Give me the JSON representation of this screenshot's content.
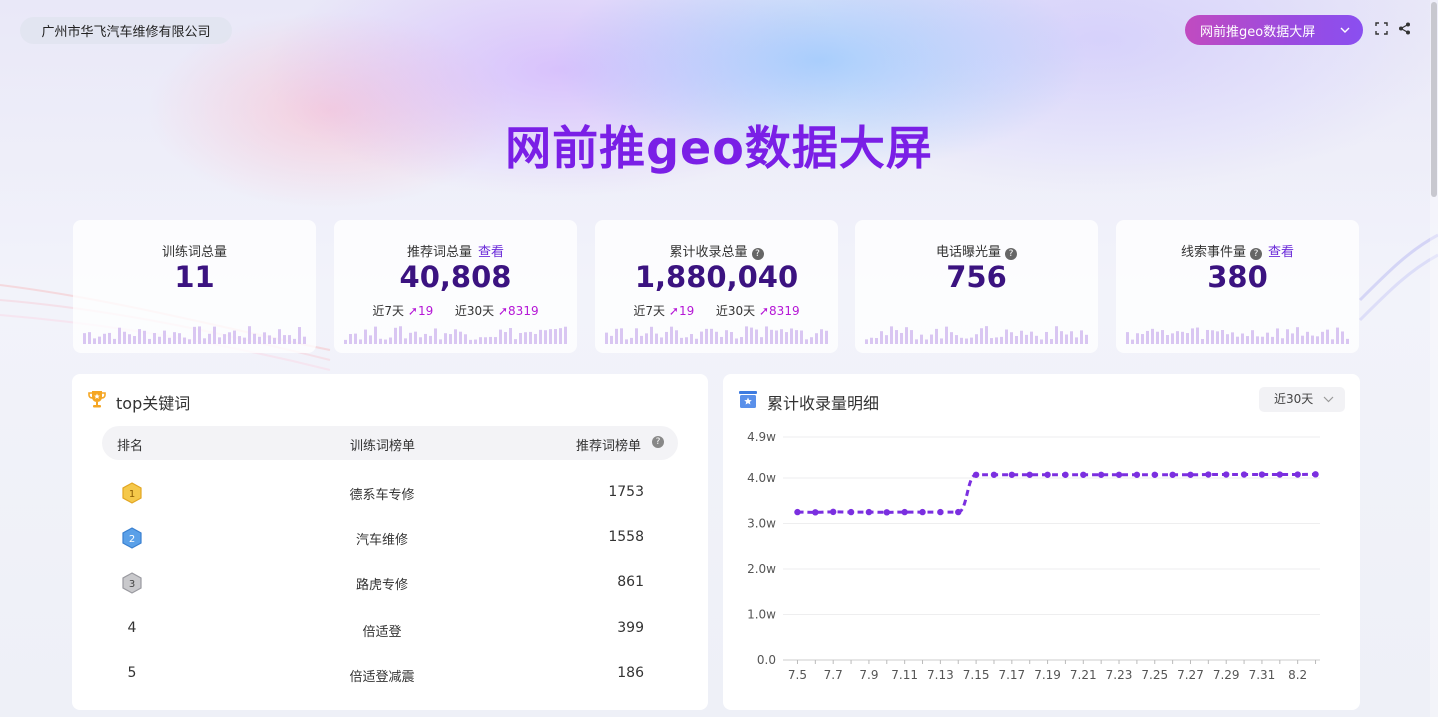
{
  "header": {
    "company": "广州市华飞汽车维修有限公司",
    "screen_select": "网前推geo数据大屏",
    "title": "网前推geo数据大屏"
  },
  "stats": [
    {
      "label": "训练词总量",
      "value": "11",
      "link": "",
      "help": false
    },
    {
      "label": "推荐词总量",
      "value": "40,808",
      "link": "查看",
      "help": false,
      "trend": {
        "label7": "近7天",
        "val7": "19",
        "label30": "近30天",
        "val30": "8319"
      }
    },
    {
      "label": "累计收录总量",
      "value": "1,880,040",
      "link": "",
      "help": true,
      "trend": {
        "label7": "近7天",
        "val7": "19",
        "label30": "近30天",
        "val30": "8319"
      }
    },
    {
      "label": "电话曝光量",
      "value": "756",
      "link": "",
      "help": true
    },
    {
      "label": "线索事件量",
      "value": "380",
      "link": "查看",
      "help": true
    }
  ],
  "top_keywords": {
    "title": "top关键词",
    "headers": {
      "rank": "排名",
      "train": "训练词榜单",
      "recommend": "推荐词榜单"
    },
    "rows": [
      {
        "rank": "1",
        "keyword": "德系车专修",
        "count": "1753"
      },
      {
        "rank": "2",
        "keyword": "汽车维修",
        "count": "1558"
      },
      {
        "rank": "3",
        "keyword": "路虎专修",
        "count": "861"
      },
      {
        "rank": "4",
        "keyword": "倍适登",
        "count": "399"
      },
      {
        "rank": "5",
        "keyword": "倍适登减震",
        "count": "186"
      }
    ]
  },
  "records_panel": {
    "title": "累计收录量明细",
    "period": "近30天"
  },
  "chart_data": {
    "type": "line",
    "title": "",
    "xlabel": "",
    "ylabel": "",
    "x": [
      "7.5",
      "7.6",
      "7.7",
      "7.8",
      "7.9",
      "7.10",
      "7.11",
      "7.12",
      "7.13",
      "7.14",
      "7.15",
      "7.16",
      "7.17",
      "7.18",
      "7.19",
      "7.20",
      "7.21",
      "7.22",
      "7.23",
      "7.24",
      "7.25",
      "7.26",
      "7.27",
      "7.28",
      "7.29",
      "7.30",
      "7.31",
      "8.1",
      "8.2",
      "8.3"
    ],
    "x_tick_labels": [
      "7.5",
      "7.7",
      "7.9",
      "7.11",
      "7.13",
      "7.15",
      "7.17",
      "7.19",
      "7.21",
      "7.23",
      "7.25",
      "7.27",
      "7.29",
      "7.31",
      "8.2"
    ],
    "series": [
      {
        "values": [
          32500,
          32450,
          32550,
          32500,
          32500,
          32450,
          32500,
          32500,
          32500,
          32500,
          40700,
          40700,
          40700,
          40700,
          40700,
          40700,
          40700,
          40700,
          40700,
          40700,
          40700,
          40700,
          40700,
          40750,
          40750,
          40750,
          40750,
          40750,
          40750,
          40800
        ]
      }
    ],
    "y_tick_labels": [
      "0.0",
      "1.0w",
      "2.0w",
      "3.0w",
      "4.0w",
      "4.9w"
    ],
    "ylim": [
      0,
      49000
    ],
    "grid": true,
    "color": "#7b2fe0"
  },
  "colors": {
    "accent": "#7a1fe6",
    "value": "#3b1380",
    "trend_up": "#b517d6",
    "line": "#7b2fe0"
  }
}
